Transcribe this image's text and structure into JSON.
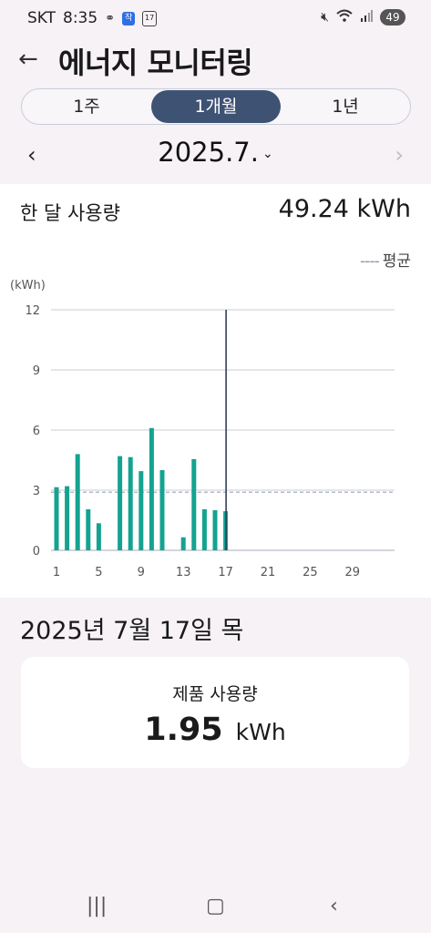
{
  "status_bar": {
    "carrier": "SKT",
    "time": "8:35",
    "cal_icon_text": "17",
    "blue_icon_text": "작",
    "battery": "49"
  },
  "header": {
    "title": "에너지 모니터링"
  },
  "segments": [
    {
      "label": "1주",
      "active": false
    },
    {
      "label": "1개월",
      "active": true
    },
    {
      "label": "1년",
      "active": false
    }
  ],
  "month": {
    "label": "2025.7."
  },
  "summary": {
    "label": "한 달 사용량",
    "value": "49.24 kWh"
  },
  "legend": {
    "average_label": "평균"
  },
  "chart_data": {
    "type": "bar",
    "ylabel": "(kWh)",
    "ylim": [
      0,
      12
    ],
    "yticks": [
      0,
      3,
      6,
      9,
      12
    ],
    "xlim": [
      1,
      32
    ],
    "xticks": [
      1,
      5,
      9,
      13,
      17,
      21,
      25,
      29
    ],
    "days": [
      1,
      2,
      3,
      4,
      5,
      6,
      7,
      8,
      9,
      10,
      11,
      12,
      13,
      14,
      15,
      16,
      17
    ],
    "values": [
      3.15,
      3.2,
      4.8,
      2.05,
      1.35,
      0,
      4.7,
      4.65,
      3.95,
      6.1,
      4.0,
      0,
      0.65,
      4.55,
      2.05,
      2.0,
      1.95
    ],
    "average": 2.9,
    "selected_day": 17,
    "bar_color": "#14a390",
    "grid": true
  },
  "detail": {
    "date": "2025년 7월 17일 목",
    "label": "제품 사용량",
    "value": "1.95",
    "unit": "kWh"
  }
}
